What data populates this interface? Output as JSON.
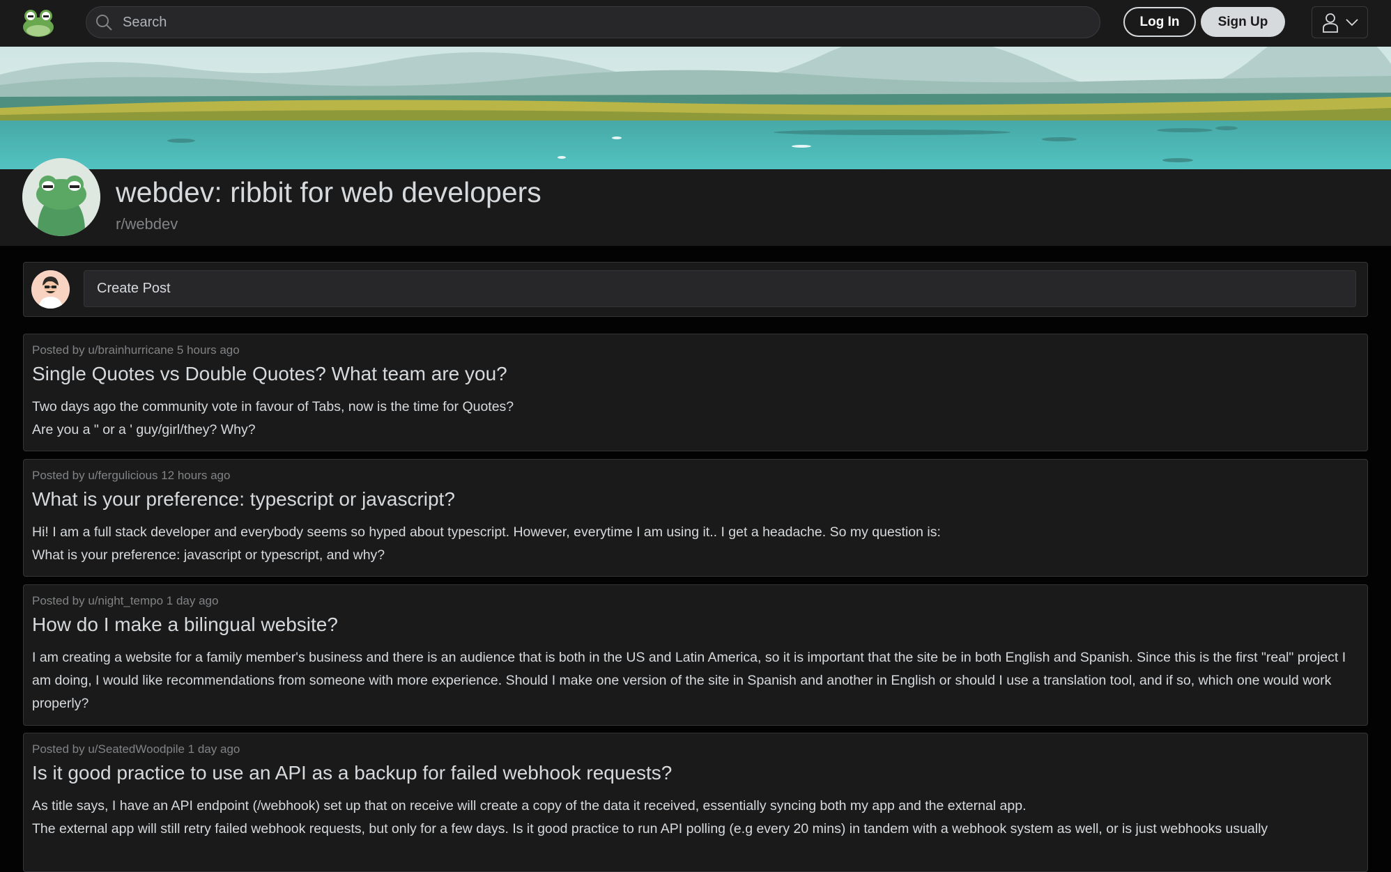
{
  "search": {
    "placeholder": "Search"
  },
  "auth": {
    "login_label": "Log In",
    "signup_label": "Sign Up"
  },
  "subreddit": {
    "title": "webdev: ribbit for web developers",
    "name": "r/webdev"
  },
  "create_post": {
    "placeholder": "Create Post"
  },
  "posts": [
    {
      "meta": "Posted by u/brainhurricane 5 hours ago",
      "title": "Single Quotes vs Double Quotes? What team are you?",
      "body": [
        "Two days ago the community vote in favour of Tabs, now is the time for Quotes?",
        "Are you a \" or a ' guy/girl/they? Why?"
      ]
    },
    {
      "meta": "Posted by u/fergulicious 12 hours ago",
      "title": "What is your preference: typescript or javascript?",
      "body": [
        "Hi! I am a full stack developer and everybody seems so hyped about typescript. However, everytime I am using it.. I get a headache. So my question is:",
        "What is your preference: javascript or typescript, and why?"
      ]
    },
    {
      "meta": "Posted by u/night_tempo 1 day ago",
      "title": "How do I make a bilingual website?",
      "body": [
        "I am creating a website for a family member's business and there is an audience that is both in the US and Latin America, so it is important that the site be in both English and Spanish. Since this is the first \"real\" project I am doing, I would like recommendations from someone with more experience. Should I make one version of the site in Spanish and another in English or should I use a translation tool, and if so, which one would work properly?"
      ]
    },
    {
      "meta": "Posted by u/SeatedWoodpile 1 day ago",
      "title": "Is it good practice to use an API as a backup for failed webhook requests?",
      "body": [
        "As title says, I have an API endpoint (/webhook) set up that on receive will create a copy of the data it received, essentially syncing both my app and the external app.",
        "The external app will still retry failed webhook requests, but only for a few days. Is it good practice to run API polling (e.g every 20 mins) in tandem with a webhook system as well, or is just webhooks usually"
      ]
    }
  ],
  "colors": {
    "page_bg": "#030303",
    "panel_bg": "#1a1a1b",
    "border": "#343536",
    "text": "#d7dadc",
    "muted": "#818384",
    "frog_green": "#4f9a5e"
  },
  "icons": [
    "frog-logo-icon",
    "search-icon",
    "user-icon",
    "chevron-down-icon",
    "subreddit-frog-avatar",
    "user-avatar"
  ]
}
